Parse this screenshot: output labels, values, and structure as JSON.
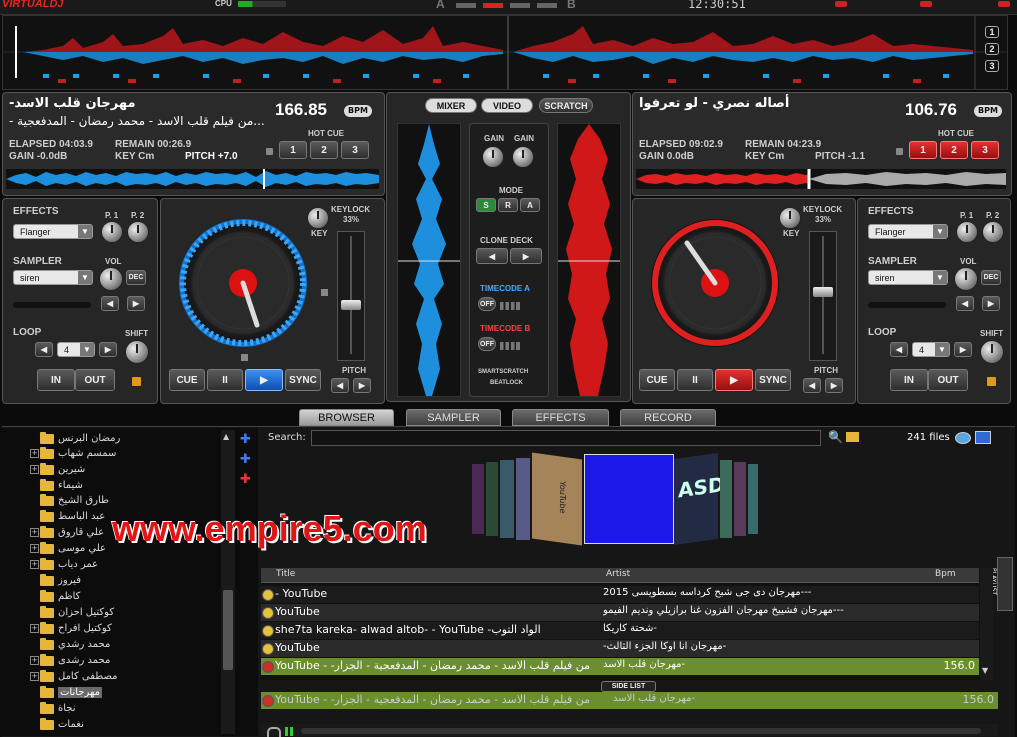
{
  "topbar": {
    "logo": "VIRTUALDJ",
    "cpu_label": "CPU",
    "crossfader_a": "A",
    "crossfader_b": "B",
    "clock": "12:30:51",
    "track_buttons": [
      "1",
      "2",
      "3"
    ]
  },
  "deck_left": {
    "title": "مهرجان قلب الاسد-",
    "subtitle": "- من فيلم قلب الاسد - محمد رمضان - المدفعجية...",
    "bpm": "166.85",
    "bpm_badge": "BPM",
    "elapsed": "ELAPSED 04:03.9",
    "remain": "REMAIN 00:26.9",
    "gain": "GAIN -0.0dB",
    "key": "KEY Cm",
    "pitch": "PITCH +7.0",
    "hot_cue_label": "HOT CUE",
    "hot_cues": [
      "1",
      "2",
      "3"
    ],
    "effects_label": "EFFECTS",
    "effect_value": "Flanger",
    "p1": "P. 1",
    "p2": "P. 2",
    "sampler_label": "SAMPLER",
    "sampler_value": "siren",
    "vol": "VOL",
    "dec": "DEC",
    "loop_label": "LOOP",
    "loop_value": "4",
    "shift": "SHIFT",
    "in": "IN",
    "out": "OUT",
    "keylock": "KEYLOCK",
    "keylock_pct": "33%",
    "key_knob": "KEY",
    "pitch_label": "PITCH",
    "cue": "CUE",
    "pause": "II",
    "play": "▶",
    "sync": "SYNC"
  },
  "deck_right": {
    "title": "أصاله نصري - لو تعرفوا",
    "bpm": "106.76",
    "bpm_badge": "BPM",
    "elapsed": "ELAPSED 09:02.9",
    "remain": "REMAIN 04:23.9",
    "gain": "GAIN 0.0dB",
    "key": "KEY Cm",
    "pitch": "PITCH -1.1",
    "hot_cue_label": "HOT CUE",
    "hot_cues": [
      "1",
      "2",
      "3"
    ],
    "effects_label": "EFFECTS",
    "effect_value": "Flanger",
    "p1": "P. 1",
    "p2": "P. 2",
    "sampler_label": "SAMPLER",
    "sampler_value": "siren",
    "vol": "VOL",
    "dec": "DEC",
    "loop_label": "LOOP",
    "loop_value": "4",
    "shift": "SHIFT",
    "in": "IN",
    "out": "OUT",
    "keylock": "KEYLOCK",
    "keylock_pct": "33%",
    "key_knob": "KEY",
    "pitch_label": "PITCH",
    "cue": "CUE",
    "pause": "II",
    "play": "▶",
    "sync": "SYNC"
  },
  "mixer": {
    "tabs": [
      "MIXER",
      "VIDEO",
      "SCRATCH"
    ],
    "gain1": "GAIN",
    "gain2": "GAIN",
    "mode": "MODE",
    "mode_buttons": [
      "S",
      "R",
      "A"
    ],
    "clone_deck": "CLONE DECK",
    "timecode_a": "TIMECODE A",
    "timecode_b": "TIMECODE B",
    "off": "OFF",
    "smartscratch": "SMARTSCRATCH",
    "beatlock": "BEATLOCK"
  },
  "tabs": [
    "BROWSER",
    "SAMPLER",
    "EFFECTS",
    "RECORD"
  ],
  "browser": {
    "search_label": "Search:",
    "search_value": "",
    "file_count": "241 files",
    "side_tab": "PLAYLIST",
    "side_list": "SIDE LIST",
    "watermark": "www.empire5.com",
    "folders": [
      "رمضان البرنس",
      "سمسم شهاب",
      "شيرين",
      "شيماء",
      "طارق الشيخ",
      "عبد الباسط",
      "علي قاروق",
      "علي موسى",
      "عمر دياب",
      "فيروز",
      "كاظم",
      "كوكتيل احزان",
      "كوكتيل افراح",
      "محمد رشدي",
      "محمد رشدى",
      "مصطفى كامل",
      "مهرجانات",
      "نجاة",
      "نغمات"
    ],
    "columns": {
      "title": "Title",
      "artist": "Artist",
      "bpm": "Bpm"
    },
    "rows": [
      {
        "title": "- YouTube",
        "artist": "مهرجان دى جى شبح كرداسه بسطويسى 2015---",
        "bpm": ""
      },
      {
        "title": "YouTube",
        "artist": "مهرجان فشييخ مهرجان الفزون غنا برازيلي ونديم الفيمو---",
        "bpm": ""
      },
      {
        "title": "she7ta kareka- alwad altob- - YouTube -الواد التوب",
        "artist": "شحتة كاريكا-",
        "bpm": ""
      },
      {
        "title": "YouTube",
        "artist": "-مهرجان انا اوكا الجزء الثالث-",
        "bpm": ""
      },
      {
        "title": "YouTube - -من فيلم قلب الاسد - محمد رمضان - المدفعجية - الجزار",
        "artist": "مهرجان قلب الاسد-",
        "bpm": "156.0"
      }
    ],
    "side_row": {
      "title": "YouTube - -من فيلم قلب الاسد - محمد رمضان - المدفعجية - الجزار",
      "artist": "مهرجان قلب الاسد-",
      "bpm": "156.0"
    },
    "cover_texts": [
      "YouTube",
      "ASD"
    ]
  },
  "colors": {
    "accent_blue": "#1a8fe0",
    "accent_red": "#e02020",
    "green_row": "#6b8e2f"
  }
}
